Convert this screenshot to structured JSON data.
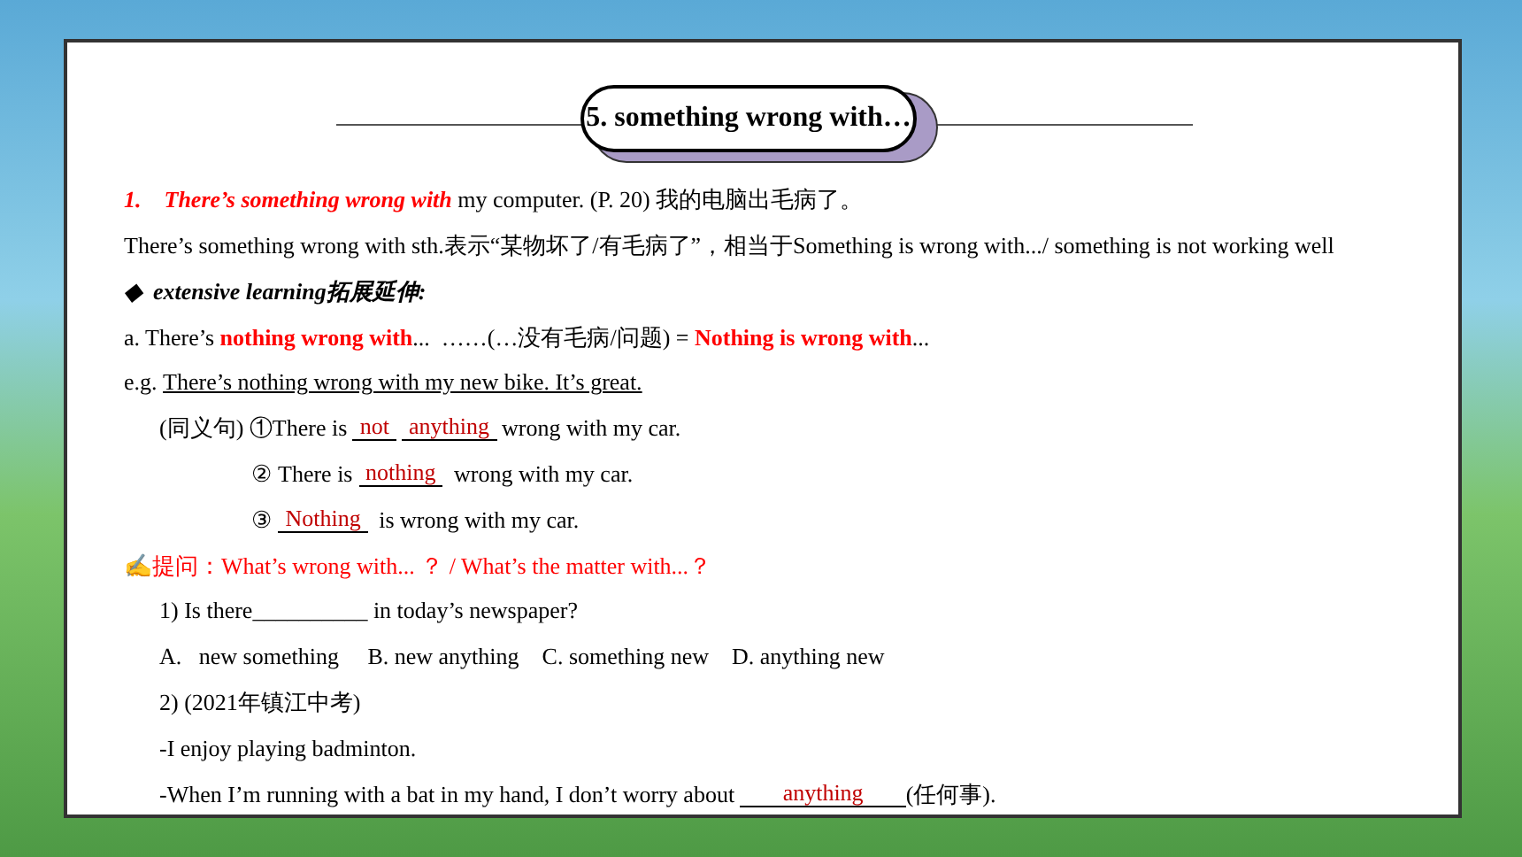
{
  "title": "5. something wrong with…",
  "lines": [
    {
      "kind": "body",
      "segments": [
        {
          "kind": "red-bold-italic",
          "text": "1.    There’s something wrong with"
        },
        {
          "kind": "plain",
          "text": " my computer. (P. 20) 我的电脑出毛病了。"
        }
      ]
    },
    {
      "kind": "body",
      "segments": [
        {
          "kind": "plain",
          "text": "There’s something wrong with sth.表示“某物坏了/有毛病了”，相当于Something is wrong with.../ something is not working well"
        }
      ]
    },
    {
      "kind": "body",
      "segments": [
        {
          "kind": "bold-italic",
          "text": "◆  extensive learning拓展延伸:"
        }
      ]
    },
    {
      "kind": "body",
      "segments": [
        {
          "kind": "plain",
          "text": "a. There’s "
        },
        {
          "kind": "red-bold",
          "text": "nothing wrong with"
        },
        {
          "kind": "plain",
          "text": "...  ……(…没有毛病/问题) = "
        },
        {
          "kind": "red-bold",
          "text": "Nothing is wrong with"
        },
        {
          "kind": "plain",
          "text": "..."
        }
      ]
    },
    {
      "kind": "body",
      "segments": [
        {
          "kind": "plain",
          "text": "e.g. "
        },
        {
          "kind": "underline",
          "text": "There’s nothing wrong with my new bike. It’s great."
        }
      ]
    },
    {
      "kind": "indent",
      "segments": [
        {
          "kind": "plain",
          "text": "(同义句) ①There is "
        },
        {
          "kind": "blank",
          "text": "not"
        },
        {
          "kind": "blank",
          "text": "anything"
        },
        {
          "kind": "plain",
          "text": "wrong with my car."
        }
      ]
    },
    {
      "kind": "deep",
      "segments": [
        {
          "kind": "plain",
          "text": "② There is "
        },
        {
          "kind": "blank",
          "text": "nothing"
        },
        {
          "kind": "plain",
          "text": " wrong with my car."
        }
      ]
    },
    {
      "kind": "deep",
      "segments": [
        {
          "kind": "plain",
          "text": "③ "
        },
        {
          "kind": "blank",
          "text": "Nothing"
        },
        {
          "kind": "plain",
          "text": " is wrong with my car."
        }
      ]
    },
    {
      "kind": "body",
      "segments": [
        {
          "kind": "red",
          "text": "✍提问：What’s wrong with... ？ / What’s the matter with...？"
        }
      ]
    },
    {
      "kind": "indent",
      "segments": [
        {
          "kind": "plain",
          "text": "1) Is there__________ in today’s newspaper?"
        }
      ]
    },
    {
      "kind": "indent",
      "segments": [
        {
          "kind": "plain",
          "text": "A.   new something     B. new anything    C. something new    D. anything new"
        }
      ]
    },
    {
      "kind": "indent",
      "segments": [
        {
          "kind": "plain",
          "text": "2) (2021年镇江中考)"
        }
      ]
    },
    {
      "kind": "indent",
      "segments": [
        {
          "kind": "plain",
          "text": "-I enjoy playing badminton."
        }
      ]
    },
    {
      "kind": "indent",
      "segments": [
        {
          "kind": "plain",
          "text": "-When I’m running with a bat in my hand, I don’t worry about "
        },
        {
          "kind": "wideblank",
          "text": "anything"
        },
        {
          "kind": "plain",
          "text": "(任何事)."
        }
      ]
    }
  ]
}
